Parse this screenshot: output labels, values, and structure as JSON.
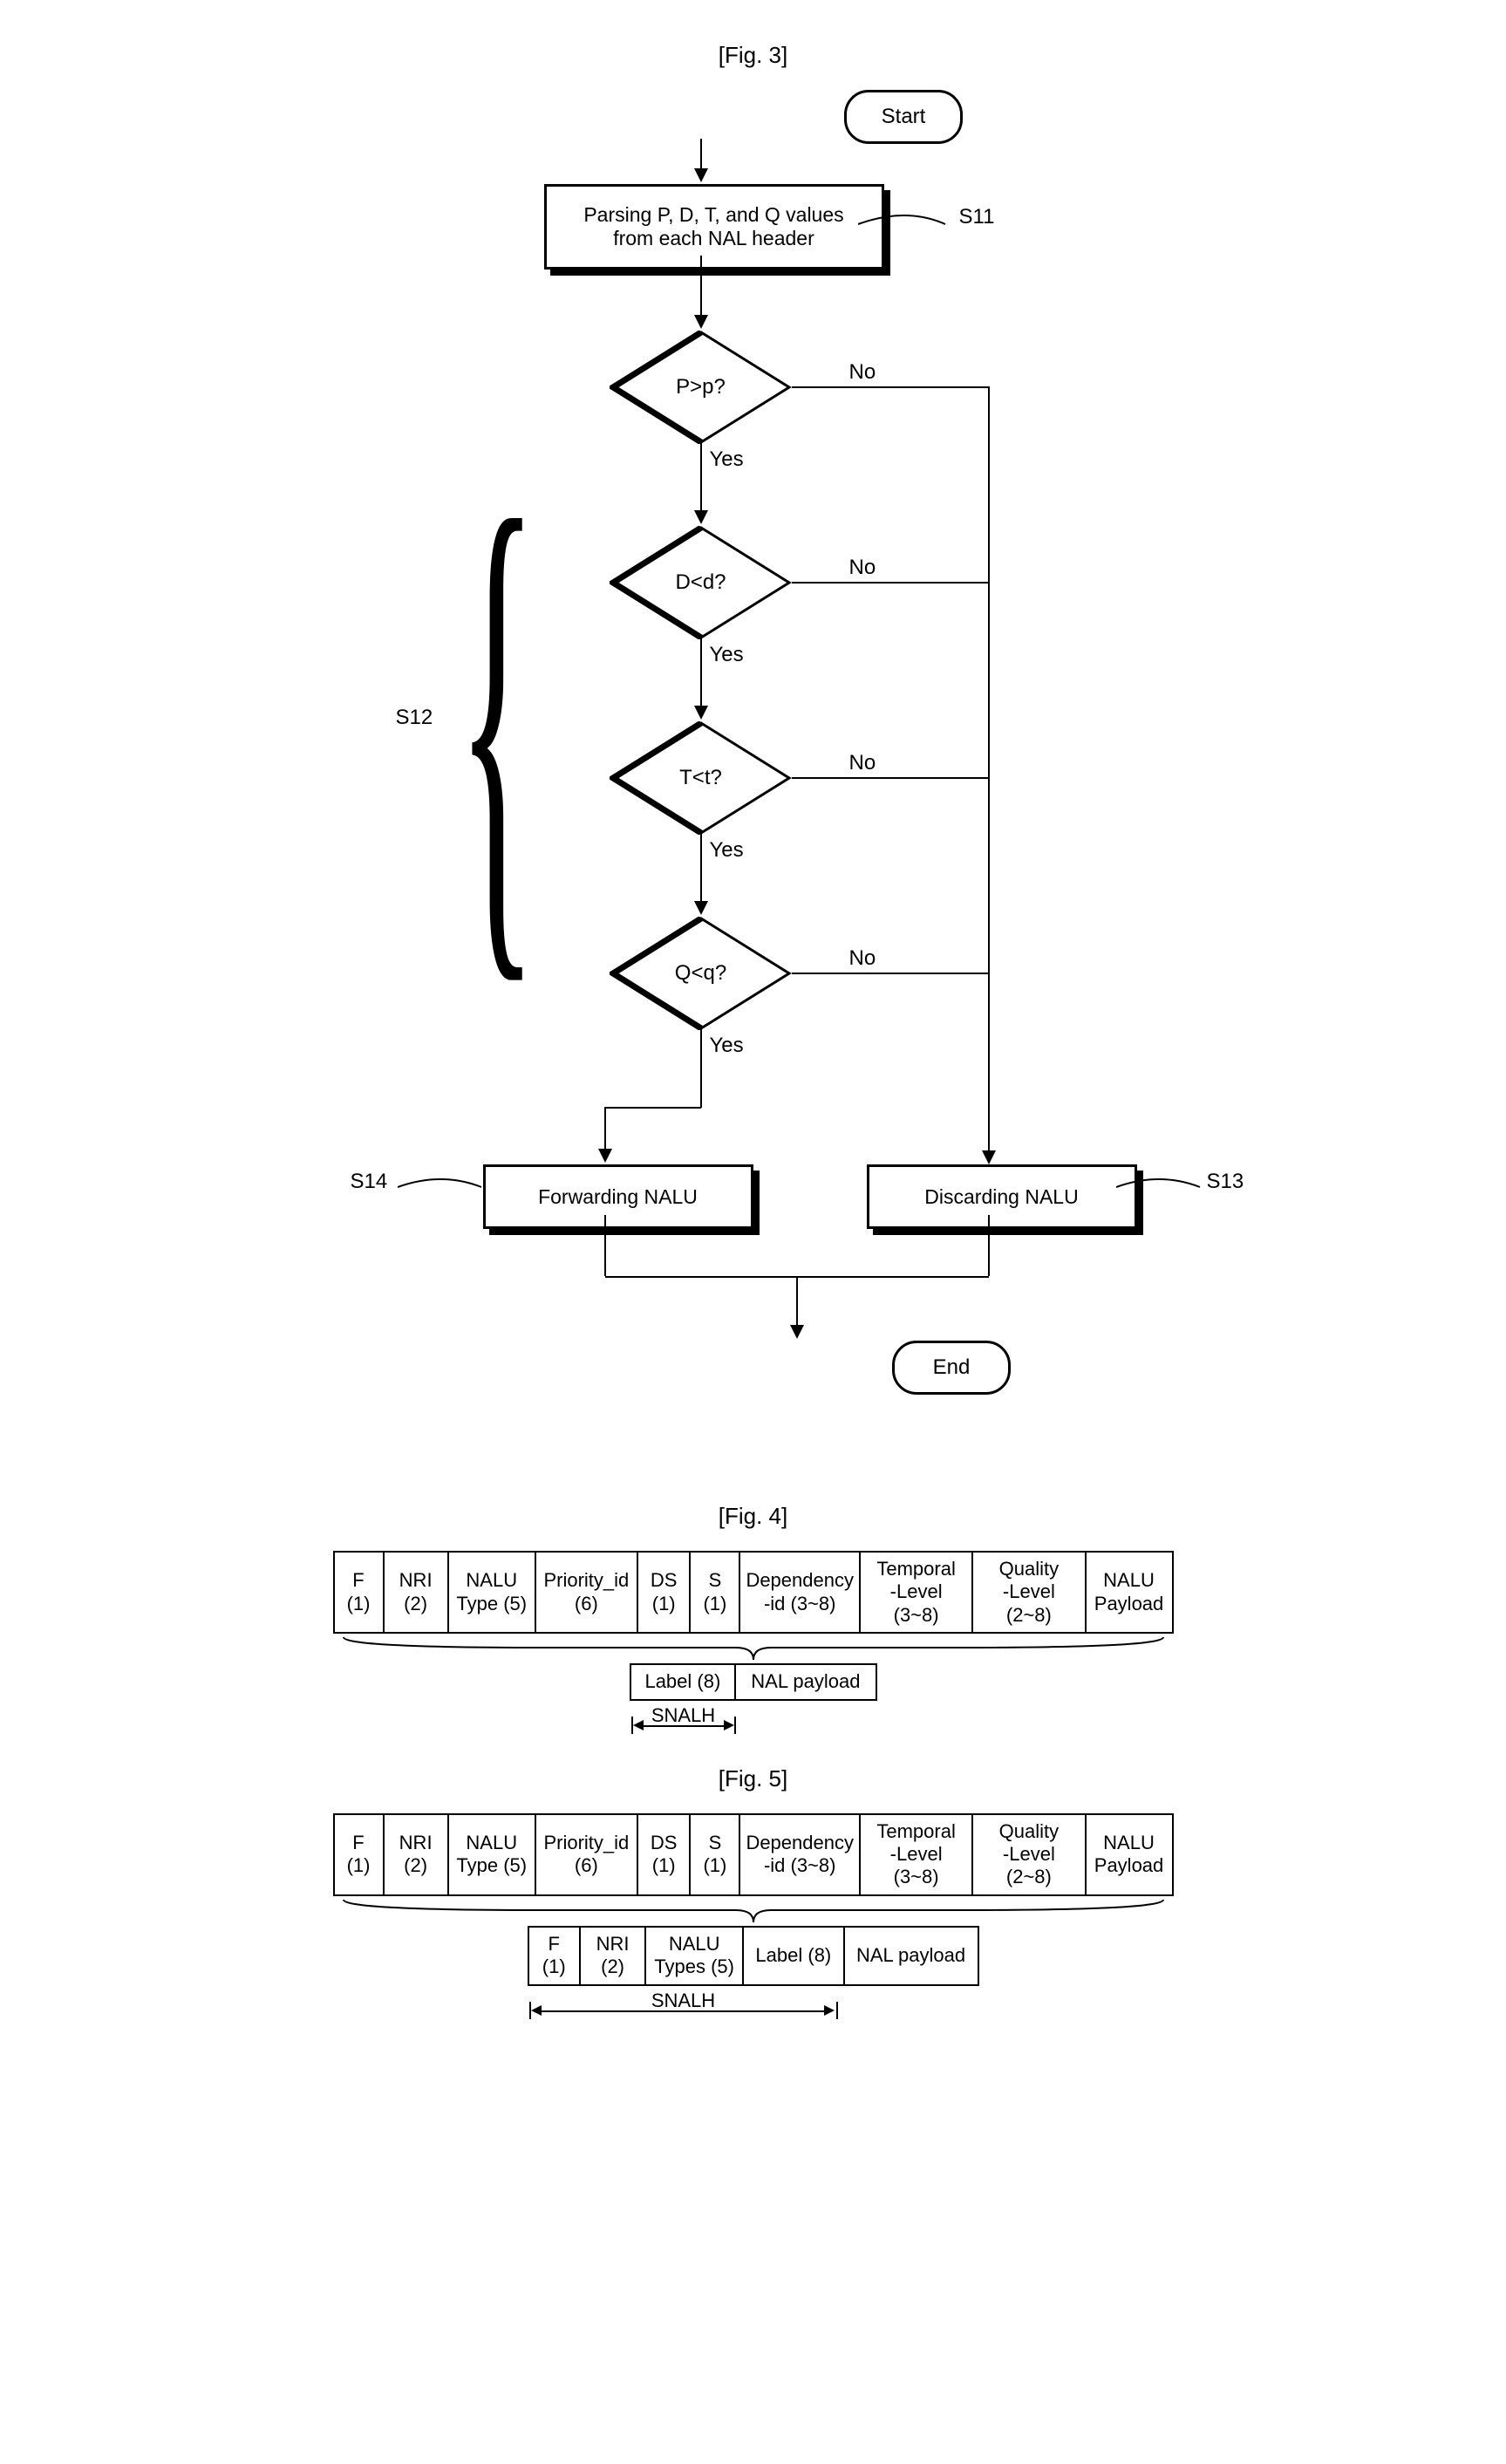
{
  "fig3": {
    "title": "[Fig. 3]",
    "start": "Start",
    "end": "End",
    "s11": {
      "ref": "S11",
      "text": "Parsing P, D, T, and Q values\nfrom each NAL header"
    },
    "s12": {
      "ref": "S12"
    },
    "s13": {
      "ref": "S13",
      "text": "Discarding NALU"
    },
    "s14": {
      "ref": "S14",
      "text": "Forwarding NALU"
    },
    "decisions": [
      {
        "text": "P>p?",
        "yes": "Yes",
        "no": "No"
      },
      {
        "text": "D<d?",
        "yes": "Yes",
        "no": "No"
      },
      {
        "text": "T<t?",
        "yes": "Yes",
        "no": "No"
      },
      {
        "text": "Q<q?",
        "yes": "Yes",
        "no": "No"
      }
    ]
  },
  "fig4": {
    "title": "[Fig. 4]",
    "top_fields": [
      {
        "label": "F",
        "bits": "(1)",
        "w": 50
      },
      {
        "label": "NRI",
        "bits": "(2)",
        "w": 70
      },
      {
        "label": "NALU",
        "bits": "Type (5)",
        "w": 100
      },
      {
        "label": "Priority_id",
        "bits": "(6)",
        "w": 120
      },
      {
        "label": "DS",
        "bits": "(1)",
        "w": 54
      },
      {
        "label": "S",
        "bits": "(1)",
        "w": 50
      },
      {
        "label": "Dependency",
        "bits": "-id (3~8)",
        "w": 140
      },
      {
        "label": "Temporal",
        "bits": "-Level (3~8)",
        "w": 134
      },
      {
        "label": "Quality",
        "bits": "-Level (2~8)",
        "w": 134
      },
      {
        "label": "NALU",
        "bits": "Payload",
        "w": 100
      }
    ],
    "bottom_fields": [
      {
        "label": "Label (8)",
        "w": 116
      },
      {
        "label": "NAL payload",
        "w": 160
      }
    ],
    "snalh": "SNALH"
  },
  "fig5": {
    "title": "[Fig. 5]",
    "top_fields": [
      {
        "label": "F",
        "bits": "(1)",
        "w": 50
      },
      {
        "label": "NRI",
        "bits": "(2)",
        "w": 70
      },
      {
        "label": "NALU",
        "bits": "Type (5)",
        "w": 100
      },
      {
        "label": "Priority_id",
        "bits": "(6)",
        "w": 120
      },
      {
        "label": "DS",
        "bits": "(1)",
        "w": 54
      },
      {
        "label": "S",
        "bits": "(1)",
        "w": 50
      },
      {
        "label": "Dependency",
        "bits": "-id (3~8)",
        "w": 140
      },
      {
        "label": "Temporal",
        "bits": "-Level (3~8)",
        "w": 134
      },
      {
        "label": "Quality",
        "bits": "-Level (2~8)",
        "w": 134
      },
      {
        "label": "NALU",
        "bits": "Payload",
        "w": 100
      }
    ],
    "bottom_fields": [
      {
        "label": "F",
        "bits": "(1)",
        "w": 52
      },
      {
        "label": "NRI",
        "bits": "(2)",
        "w": 70
      },
      {
        "label": "NALU",
        "bits": "Types (5)",
        "w": 112
      },
      {
        "label": "Label (8)",
        "w": 116
      },
      {
        "label": "NAL payload",
        "w": 160
      }
    ],
    "snalh": "SNALH"
  }
}
